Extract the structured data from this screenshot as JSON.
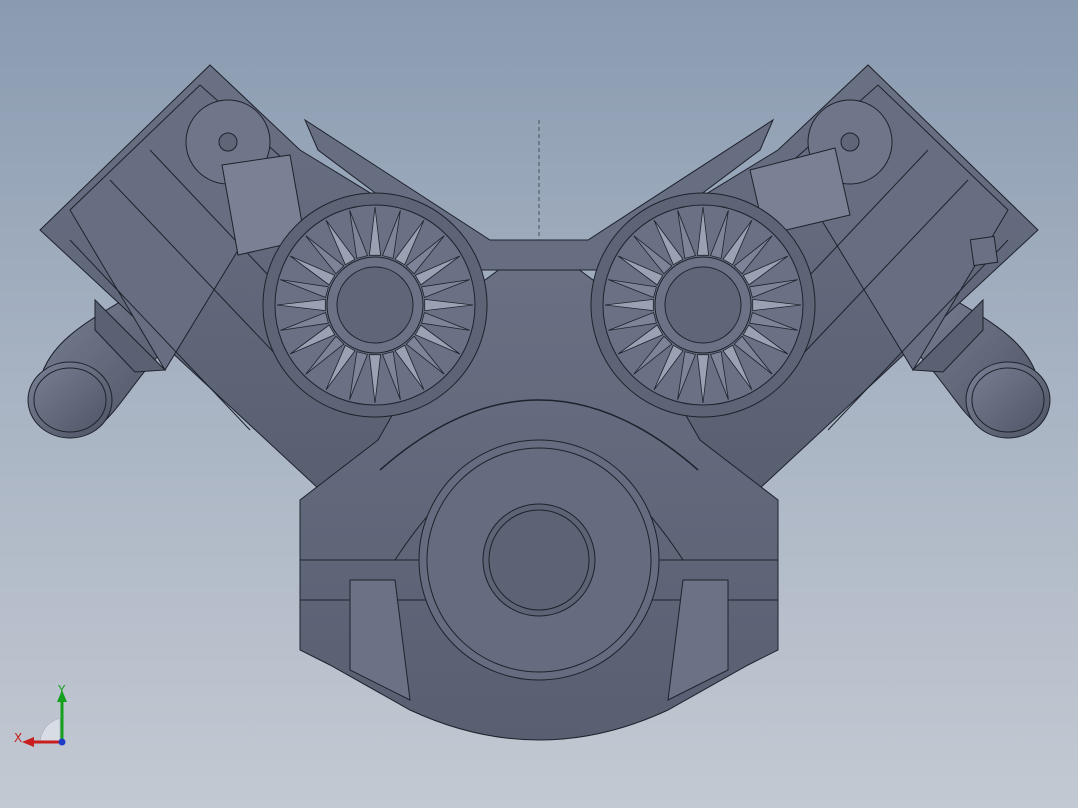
{
  "view": {
    "triad": {
      "x_label": "X",
      "y_label": "Y",
      "x_color": "#c81e1e",
      "y_color": "#15a01e",
      "z_color": "#1e3cc8"
    },
    "model": {
      "fill": "#5f6678",
      "edge": "#1e222c",
      "highlight": "#7c8396"
    },
    "background": {
      "top": "#8a9bb0",
      "bottom": "#c3c9d2"
    }
  }
}
